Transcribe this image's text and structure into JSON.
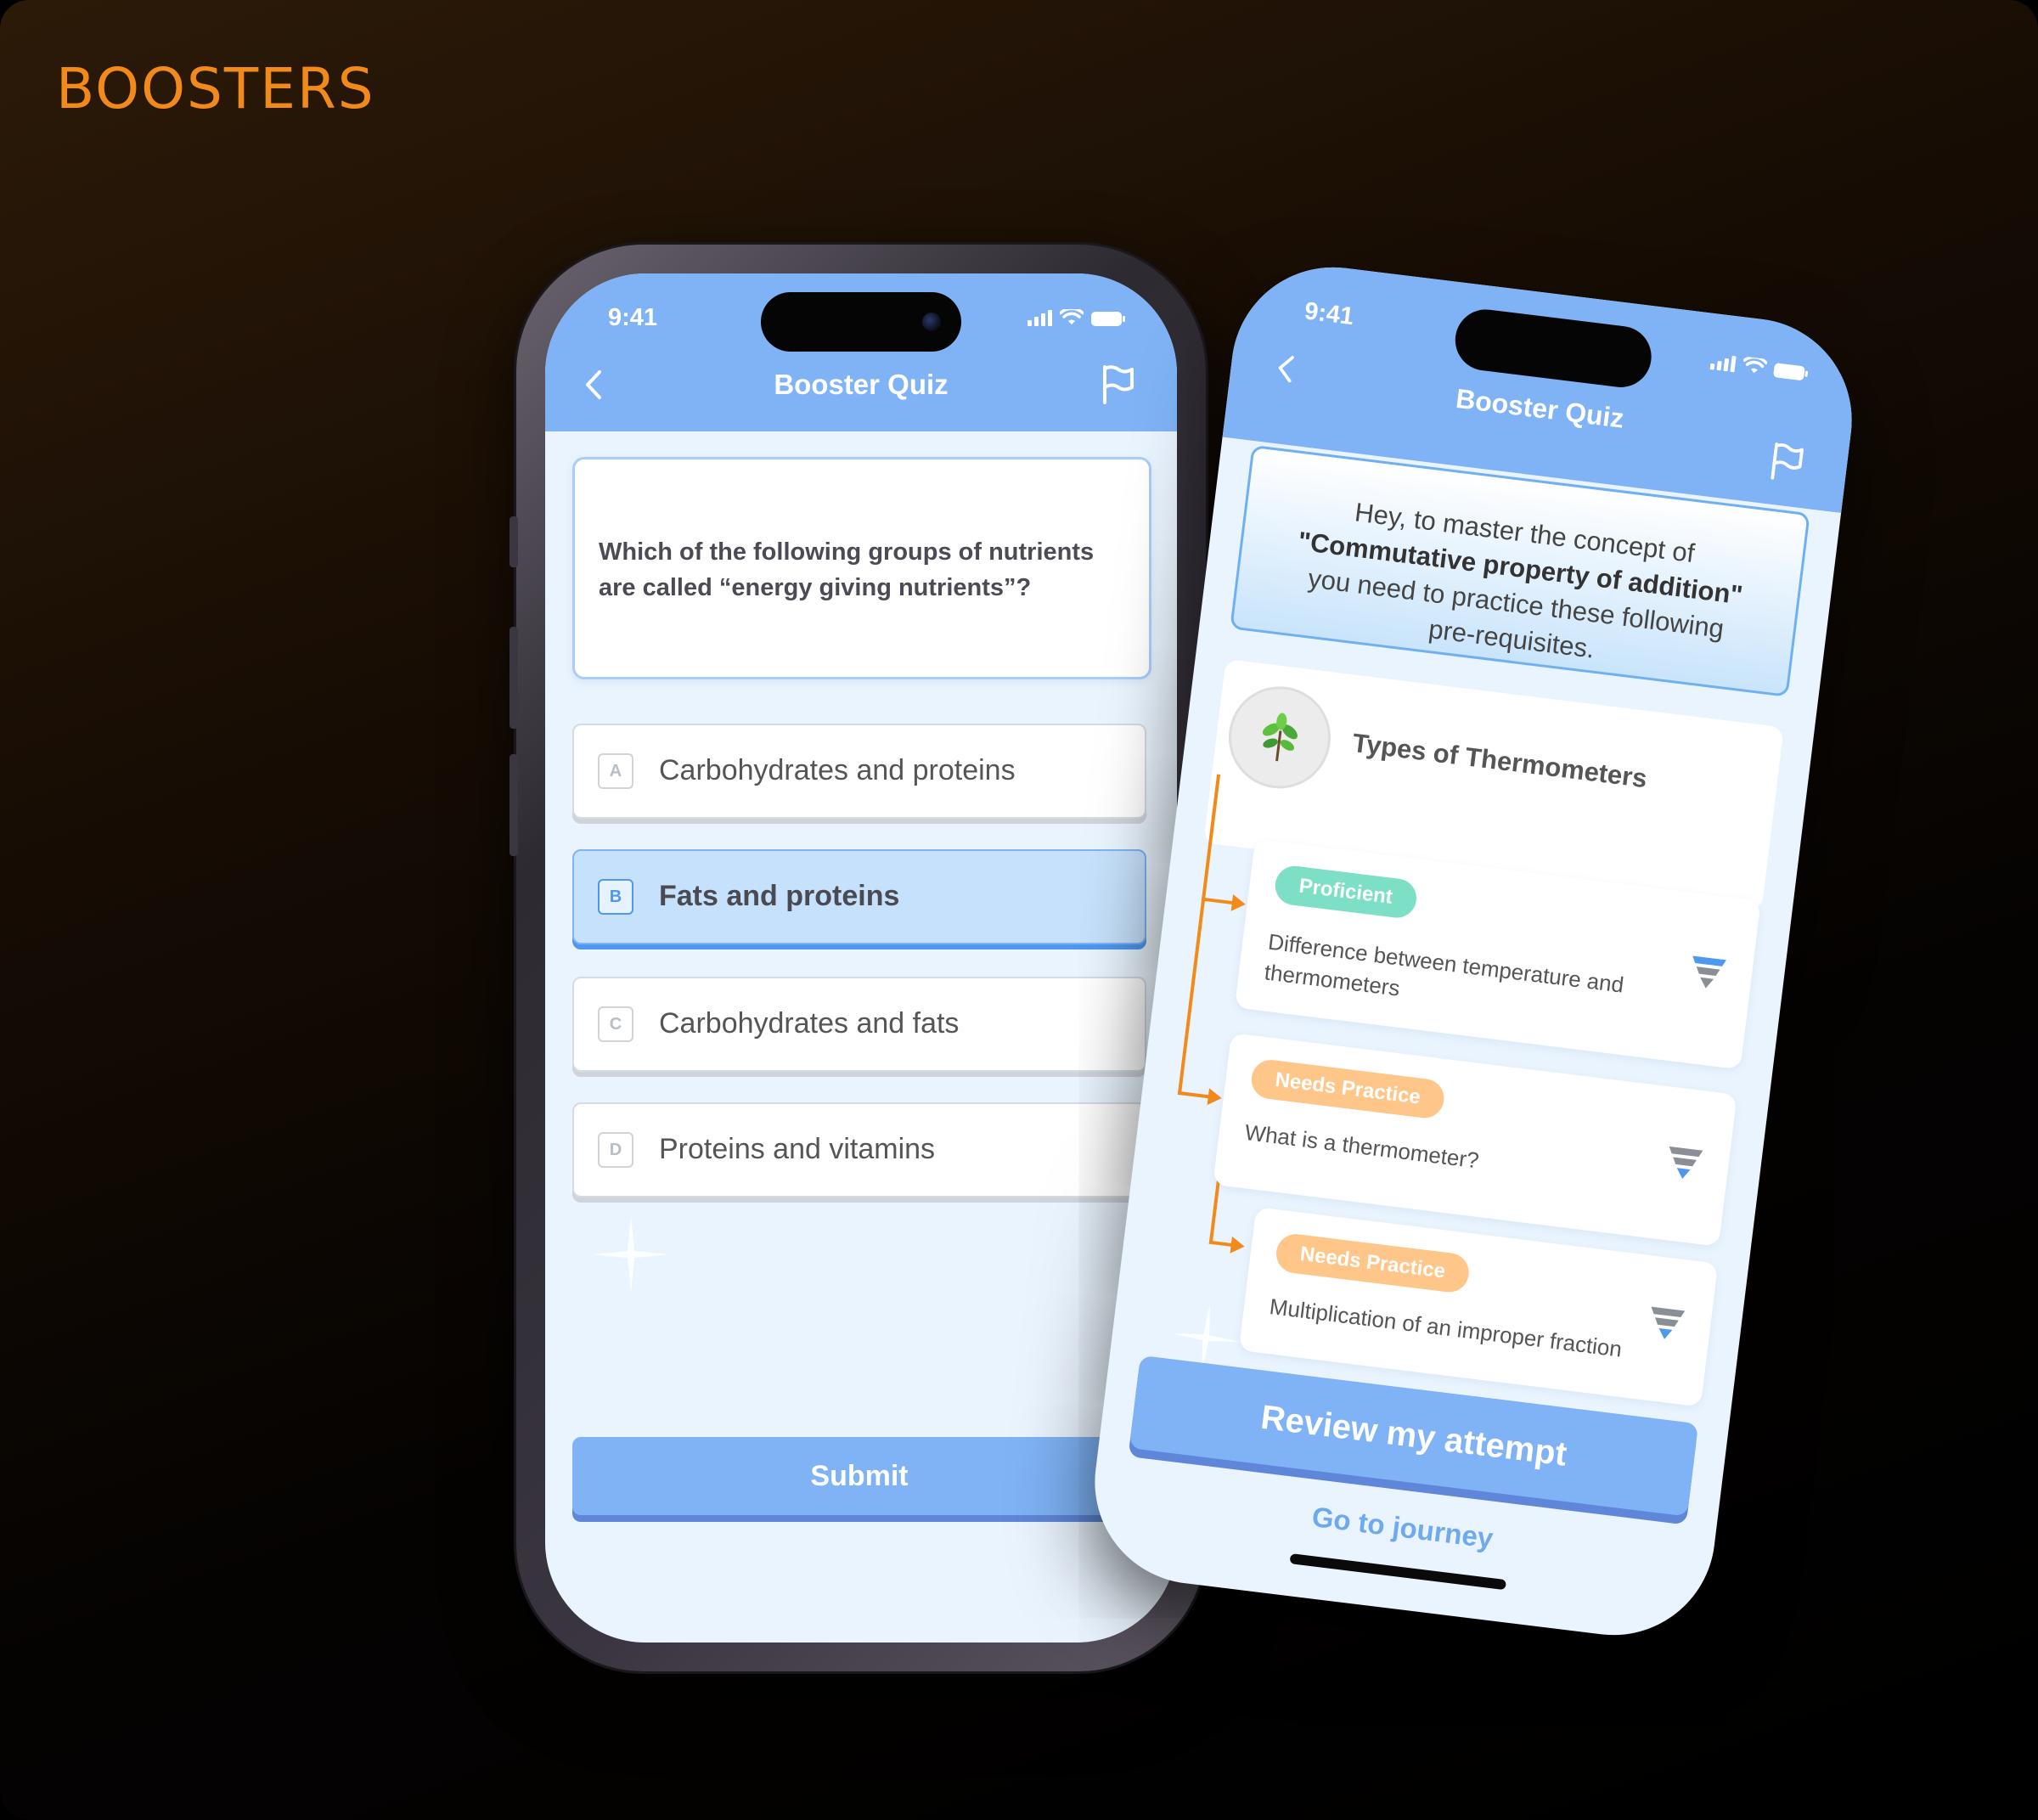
{
  "brand": "BOOSTERS",
  "phone1": {
    "time": "9:41",
    "title": "Booster Quiz",
    "question": "Which of the following groups of nutrients are called “energy giving nutrients”?",
    "options": [
      {
        "letter": "A",
        "text": "Carbohydrates and proteins",
        "selected": false
      },
      {
        "letter": "B",
        "text": "Fats and proteins",
        "selected": true
      },
      {
        "letter": "C",
        "text": "Carbohydrates and fats",
        "selected": false
      },
      {
        "letter": "D",
        "text": "Proteins and vitamins",
        "selected": false
      }
    ],
    "submit_label": "Submit"
  },
  "phone2": {
    "time": "9:41",
    "title": "Booster Quiz",
    "intro_line1": "Hey, to master the concept of",
    "intro_concept": "\"Commutative property of addition\"",
    "intro_line2": "you need to practice these following pre-requisites.",
    "topic": {
      "title": "Types of Thermometers",
      "icon": "plant-icon"
    },
    "prerequisites": [
      {
        "status": "Proficient",
        "text": "Difference between temperature and thermometers"
      },
      {
        "status": "Needs Practice",
        "text": "What is a thermometer?"
      },
      {
        "status": "Needs Practice",
        "text": "Multiplication of an improper fraction"
      }
    ],
    "review_label": "Review my attempt",
    "journey_label": "Go to journey"
  },
  "colors": {
    "header_blue": "#7fb3f6",
    "accent_orange": "#f28a1a",
    "proficient_green": "#7de0c6",
    "needs_practice_orange": "#ffc68a",
    "selected_bg": "#c6e1fb"
  }
}
